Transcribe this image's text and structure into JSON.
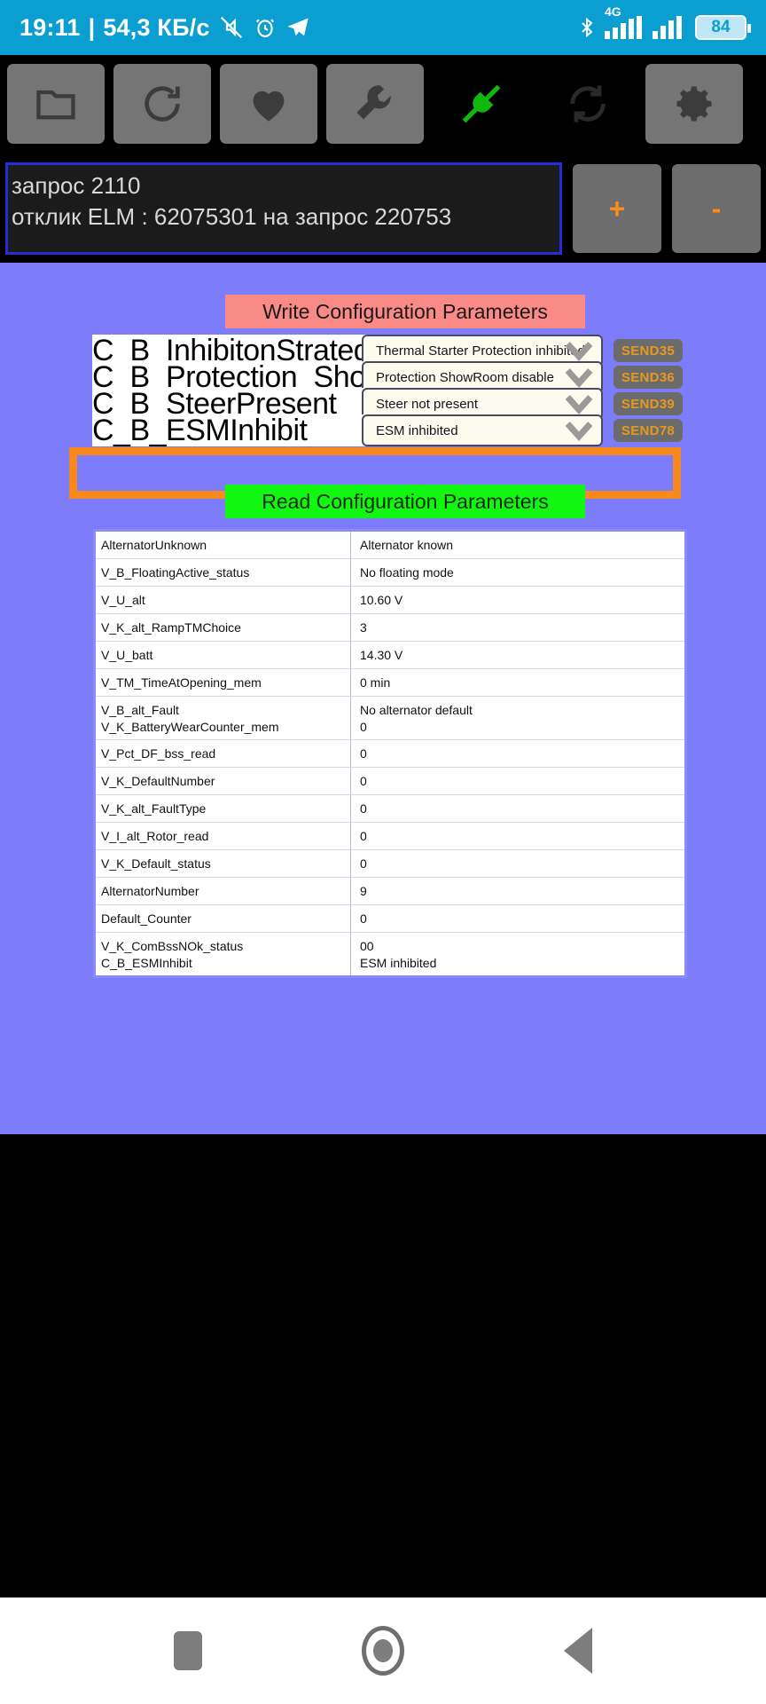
{
  "status_bar": {
    "clock": "19:11",
    "separator": "|",
    "data_rate": "54,3 КБ/с",
    "icons_left": [
      "mute-icon",
      "alarm-icon",
      "telegram-icon"
    ],
    "icons_right": [
      "bluetooth-icon",
      "signal-4g-icon",
      "signal-icon",
      "battery-icon"
    ],
    "network_label": "4G",
    "battery_level": "84"
  },
  "toolbar": {
    "buttons": [
      {
        "name": "folder-icon",
        "label": "Folder"
      },
      {
        "name": "reload-icon",
        "label": "Reload"
      },
      {
        "name": "heart-icon",
        "label": "Favorites"
      },
      {
        "name": "wrench-icon",
        "label": "Tools"
      },
      {
        "name": "plug-connected-icon",
        "label": "Connection"
      },
      {
        "name": "sync-icon",
        "label": "Sync"
      },
      {
        "name": "gear-icon",
        "label": "Settings"
      }
    ]
  },
  "log_panel": {
    "line1": "запрос 2110",
    "line2": "отклик ELM : 62075301 на запрос 220753",
    "plus_label": "+",
    "minus_label": "-"
  },
  "write_section": {
    "header": "Write Configuration Parameters",
    "rows": [
      {
        "name": "C_B_InhibitonStrategi",
        "value": "Thermal Starter Protection inhibited",
        "send": "SEND35"
      },
      {
        "name": "C_B_Protection_Show",
        "value": "Protection ShowRoom disable",
        "send": "SEND36"
      },
      {
        "name": "C_B_SteerPresent",
        "value": "Steer not present",
        "send": "SEND39"
      },
      {
        "name": "C_B_ESMInhibit",
        "value": "ESM inhibited",
        "send": "SEND78"
      }
    ],
    "highlight_color": "#f7891e"
  },
  "read_section": {
    "header": "Read Configuration Parameters",
    "table": [
      {
        "key": "AlternatorUnknown",
        "value": "Alternator known"
      },
      {
        "key": "V_B_FloatingActive_status",
        "value": "No floating mode"
      },
      {
        "key": "V_U_alt",
        "value": "10.60 V"
      },
      {
        "key": "V_K_alt_RampTMChoice",
        "value": "3"
      },
      {
        "key": "V_U_batt",
        "value": "14.30 V"
      },
      {
        "key": "V_TM_TimeAtOpening_mem",
        "value": "0 min"
      },
      {
        "key": "V_B_alt_Fault",
        "value": "No alternator default",
        "key2": "V_K_BatteryWearCounter_mem",
        "value2": "0"
      },
      {
        "key": "V_Pct_DF_bss_read",
        "value": "0"
      },
      {
        "key": "V_K_DefaultNumber",
        "value": "0"
      },
      {
        "key": "V_K_alt_FaultType",
        "value": "0"
      },
      {
        "key": "V_I_alt_Rotor_read",
        "value": "0"
      },
      {
        "key": "V_K_Default_status",
        "value": "0"
      },
      {
        "key": "AlternatorNumber",
        "value": "9"
      },
      {
        "key": "Default_Counter",
        "value": "0"
      },
      {
        "key": "V_K_ComBssNOk_status",
        "value": "00",
        "key2": "C_B_ESMInhibit",
        "value2": "ESM inhibited"
      }
    ]
  },
  "nav_bar": {
    "recents_label": "Recents",
    "home_label": "Home",
    "back_label": "Back"
  },
  "colors": {
    "status_bar": "#0a9fd0",
    "content_bg": "#7d7dfc",
    "write_header": "#fa8a85",
    "read_header": "#12f712",
    "send_button_text": "#e49a22",
    "highlight": "#f7891e",
    "log_border": "#2b2bd6"
  }
}
